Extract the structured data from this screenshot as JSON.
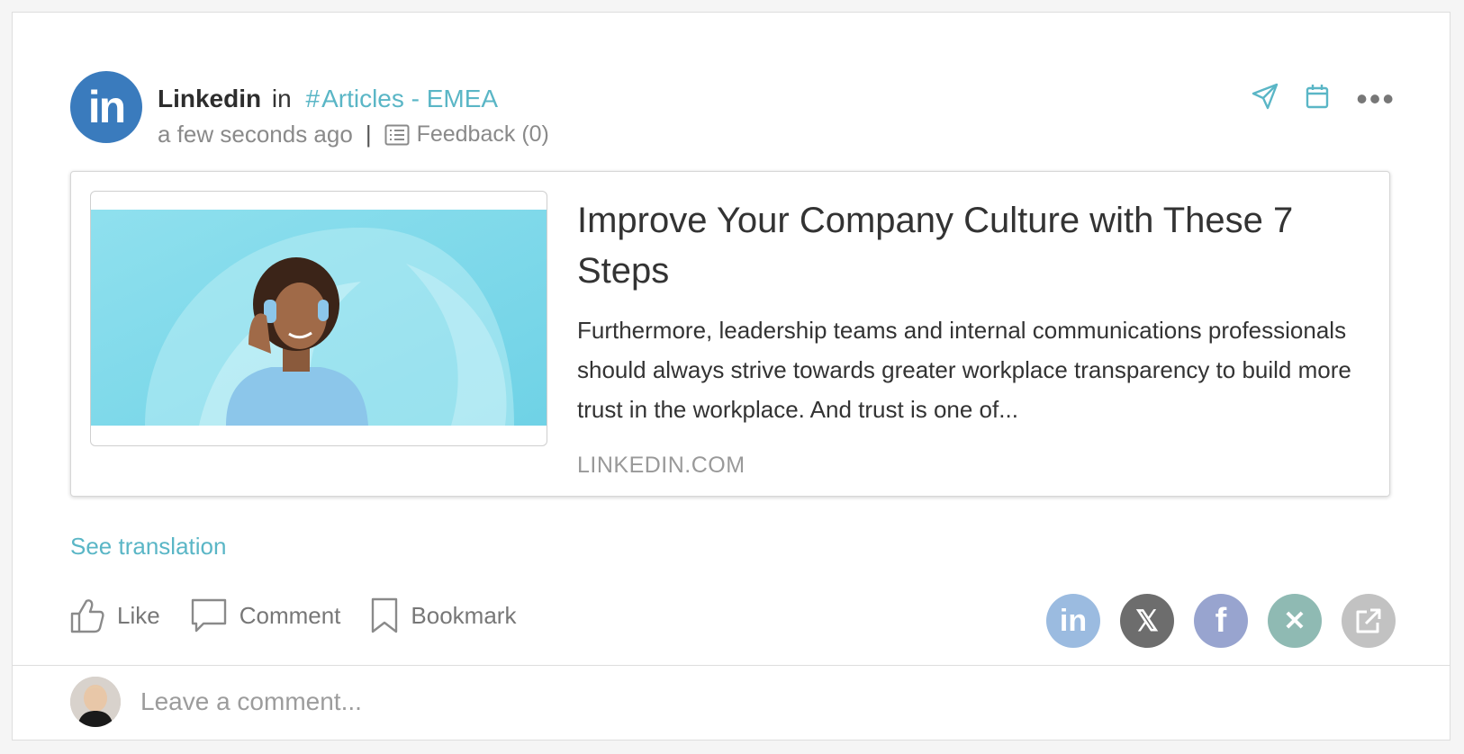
{
  "post": {
    "author": "Linkedin",
    "in_word": "in",
    "channel_hash": "#",
    "channel": "Articles - EMEA",
    "time": "a few seconds ago",
    "separator": "|",
    "feedback_label": "Feedback (0)"
  },
  "header_icons": [
    "send-icon",
    "calendar-icon",
    "more-options-icon"
  ],
  "article": {
    "title": "Improve Your Company Culture with These 7 Steps",
    "description": "Furthermore, leadership teams and internal communications professionals should always strive towards greater workplace transparency to build more trust in the workplace. And trust is one of...",
    "domain": "LINKEDIN.COM"
  },
  "see_translation": "See translation",
  "actions": {
    "like": "Like",
    "comment": "Comment",
    "bookmark": "Bookmark"
  },
  "share_buttons": [
    {
      "name": "linkedin",
      "glyph": "in",
      "color": "#9bbbe0"
    },
    {
      "name": "x",
      "glyph": "𝕏",
      "color": "#6d6d6d"
    },
    {
      "name": "facebook",
      "glyph": "f",
      "color": "#98a4cf"
    },
    {
      "name": "xing",
      "glyph": "✕",
      "color": "#8fbab3"
    },
    {
      "name": "external",
      "glyph": "↗",
      "color": "#c2c2c2"
    }
  ],
  "comment_box": {
    "placeholder": "Leave a comment..."
  },
  "colors": {
    "accent": "#5ab6c6",
    "linkedin_blue": "#3a7bbd"
  }
}
